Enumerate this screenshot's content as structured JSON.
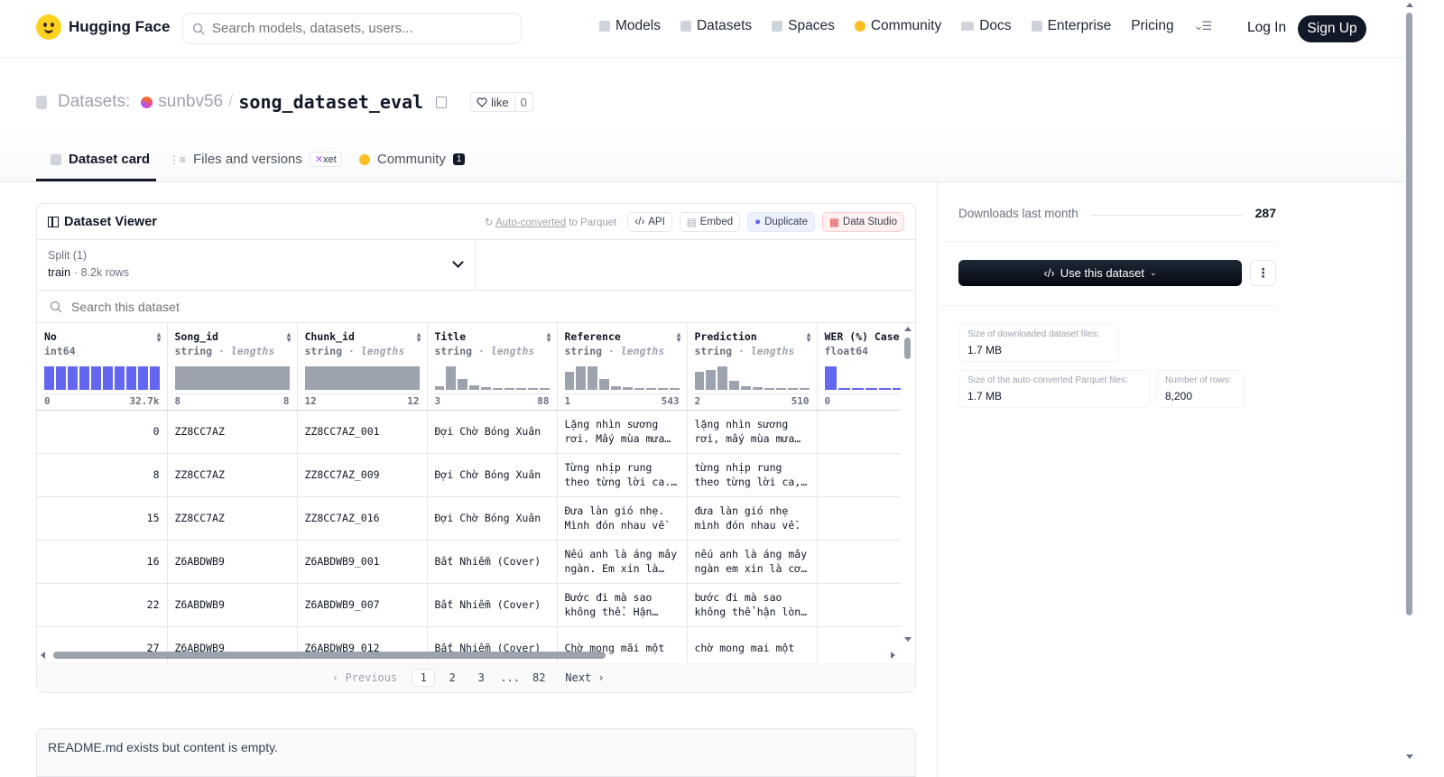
{
  "header": {
    "brand": "Hugging Face",
    "search_placeholder": "Search models, datasets, users...",
    "nav": [
      {
        "label": "Models",
        "icon": "cube-icon"
      },
      {
        "label": "Datasets",
        "icon": "database-icon"
      },
      {
        "label": "Spaces",
        "icon": "grid-icon"
      },
      {
        "label": "Community",
        "icon": "community-icon"
      },
      {
        "label": "Docs",
        "icon": "book-icon"
      },
      {
        "label": "Enterprise",
        "icon": "enterprise-icon"
      },
      {
        "label": "Pricing"
      }
    ],
    "login": "Log In",
    "signup": "Sign Up"
  },
  "repo": {
    "type_label": "Datasets:",
    "owner": "sunbv56",
    "separator": "/",
    "name": "song_dataset_eval",
    "like_label": "like",
    "like_count": "0"
  },
  "tabs": [
    {
      "label": "Dataset card",
      "active": true
    },
    {
      "label": "Files and versions",
      "badge": "xet"
    },
    {
      "label": "Community",
      "badge": "1"
    }
  ],
  "viewer": {
    "title": "Dataset Viewer",
    "auto_converted": "Auto-converted",
    "auto_converted_suffix": "to Parquet",
    "api": "API",
    "embed": "Embed",
    "duplicate": "Duplicate",
    "data_studio": "Data Studio",
    "split_label": "Split (1)",
    "split_value": "train",
    "split_rows": "8.2k rows",
    "search_placeholder": "Search this dataset",
    "columns": [
      {
        "name": "No",
        "type": "int64",
        "lengths": false,
        "min": "0",
        "max": "32.7k",
        "hist": [
          1,
          1,
          1,
          1,
          1,
          1,
          1,
          1,
          1,
          1
        ],
        "color": "blue"
      },
      {
        "name": "Song_id",
        "type": "string",
        "lengths": true,
        "min": "8",
        "max": "8",
        "hist": [
          1
        ],
        "color": "gray"
      },
      {
        "name": "Chunk_id",
        "type": "string",
        "lengths": true,
        "min": "12",
        "max": "12",
        "hist": [
          1
        ],
        "color": "gray"
      },
      {
        "name": "Title",
        "type": "string",
        "lengths": true,
        "min": "3",
        "max": "88",
        "hist": [
          0.15,
          1,
          0.45,
          0.2,
          0.1,
          0.05,
          0.05,
          0.05,
          0.05,
          0.05
        ],
        "color": "gray"
      },
      {
        "name": "Reference",
        "type": "string",
        "lengths": true,
        "min": "1",
        "max": "543",
        "hist": [
          0.75,
          1,
          1,
          0.45,
          0.15,
          0.1,
          0.05,
          0.05,
          0.05,
          0.05
        ],
        "color": "gray"
      },
      {
        "name": "Prediction",
        "type": "string",
        "lengths": true,
        "min": "2",
        "max": "510",
        "hist": [
          0.75,
          0.85,
          1,
          0.4,
          0.15,
          0.1,
          0.05,
          0.05,
          0.05,
          0.05
        ],
        "color": "gray"
      },
      {
        "name": "WER (%) Case",
        "type": "float64",
        "lengths": false,
        "min": "0",
        "max": "",
        "hist": [
          1,
          0.04,
          0.04,
          0.04,
          0.04,
          0.04,
          0.04,
          0.04
        ],
        "color": "blue"
      }
    ],
    "type_suffix": "lengths",
    "rows": [
      [
        "0",
        "ZZ8CC7AZ",
        "ZZ8CC7AZ_001",
        "Đợi Chờ Bóng Xuân",
        "Lặng nhìn sương rơi. Mấy mùa mưa…",
        "lặng nhìn sương rơi, mấy mùa mưa…",
        ""
      ],
      [
        "8",
        "ZZ8CC7AZ",
        "ZZ8CC7AZ_009",
        "Đợi Chờ Bóng Xuân",
        "Từng nhịp rung theo từng lời ca.…",
        "từng nhịp rung theo từng lời ca,…",
        ""
      ],
      [
        "15",
        "ZZ8CC7AZ",
        "ZZ8CC7AZ_016",
        "Đợi Chờ Bóng Xuân",
        "Đưa làn gió nhẹ. Mình đón nhau về",
        "đưa làn gió nhẹ mình đón nhau về.",
        ""
      ],
      [
        "16",
        "Z6ABDWB9",
        "Z6ABDWB9_001",
        "Bất Nhiễm (Cover)",
        "Nếu anh là áng mây ngàn. Em xin là…",
        "nếu anh là áng mây ngàn em xin là cơ…",
        ""
      ],
      [
        "22",
        "Z6ABDWB9",
        "Z6ABDWB9_007",
        "Bất Nhiễm (Cover)",
        "Bước đi mà sao không thể. Hận…",
        "bước đi mà sao không thể hận lòn…",
        ""
      ],
      [
        "27",
        "Z6ABDWB9",
        "Z6ABDWB9_012",
        "Bất Nhiễm (Cover)",
        "Chờ mong mãi một",
        "chờ mong mai một",
        ""
      ]
    ],
    "pagination": {
      "previous": "Previous",
      "pages": [
        "1",
        "2",
        "3",
        "...",
        "82"
      ],
      "current": "1",
      "next": "Next"
    }
  },
  "readme": "README.md exists but content is empty.",
  "sidebar": {
    "downloads_label": "Downloads last month",
    "downloads_value": "287",
    "use_button": "Use this dataset",
    "stats": [
      {
        "label": "Size of downloaded dataset files:",
        "value": "1.7 MB"
      },
      {
        "label": "Size of the auto-converted Parquet files:",
        "value": "1.7 MB"
      },
      {
        "label": "Number of rows:",
        "value": "8,200"
      }
    ]
  },
  "colors": {
    "accent_blue": "#6366f1",
    "hist_gray": "#9ca3af",
    "dark": "#111827",
    "brand_yellow": "#ffd21e"
  }
}
